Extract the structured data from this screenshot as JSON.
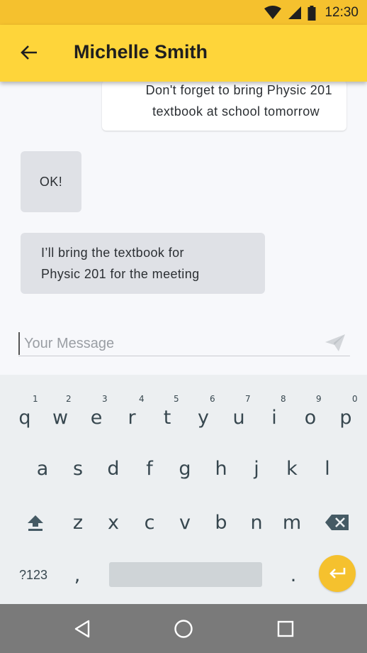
{
  "status_bar": {
    "time": "12:30",
    "icons": [
      "wifi-icon",
      "signal-icon",
      "battery-icon"
    ],
    "color": "#F5C12E"
  },
  "app_bar": {
    "title": "Michelle Smith",
    "back_icon": "arrow-back-icon",
    "color": "#FED53A"
  },
  "messages": [
    {
      "direction": "outgoing",
      "lines": [
        "Don't forget to bring Physic 201",
        "textbook at school tomorrow"
      ]
    },
    {
      "direction": "incoming",
      "lines": [
        "OK!"
      ]
    },
    {
      "direction": "incoming",
      "lines": [
        "I’ll bring the textbook for",
        "Physic 201 for the meeting"
      ]
    }
  ],
  "composer": {
    "value": "",
    "placeholder": "Your Message",
    "send_icon": "send-icon"
  },
  "keyboard": {
    "row1": [
      {
        "key": "q",
        "hint": "1"
      },
      {
        "key": "w",
        "hint": "2"
      },
      {
        "key": "e",
        "hint": "3"
      },
      {
        "key": "r",
        "hint": "4"
      },
      {
        "key": "t",
        "hint": "5"
      },
      {
        "key": "y",
        "hint": "6"
      },
      {
        "key": "u",
        "hint": "7"
      },
      {
        "key": "i",
        "hint": "8"
      },
      {
        "key": "o",
        "hint": "9"
      },
      {
        "key": "p",
        "hint": "0"
      }
    ],
    "row2": [
      "a",
      "s",
      "d",
      "f",
      "g",
      "h",
      "j",
      "k",
      "l"
    ],
    "row3": [
      "z",
      "x",
      "c",
      "v",
      "b",
      "n",
      "m"
    ],
    "symbols_label": "?123",
    "comma": ",",
    "period": ".",
    "shift_icon": "shift-icon",
    "backspace_icon": "backspace-icon",
    "enter_icon": "enter-icon",
    "enter_color": "#F5C12E"
  },
  "nav_bar": {
    "icons": [
      "back-triangle-icon",
      "home-circle-icon",
      "recents-square-icon"
    ]
  }
}
